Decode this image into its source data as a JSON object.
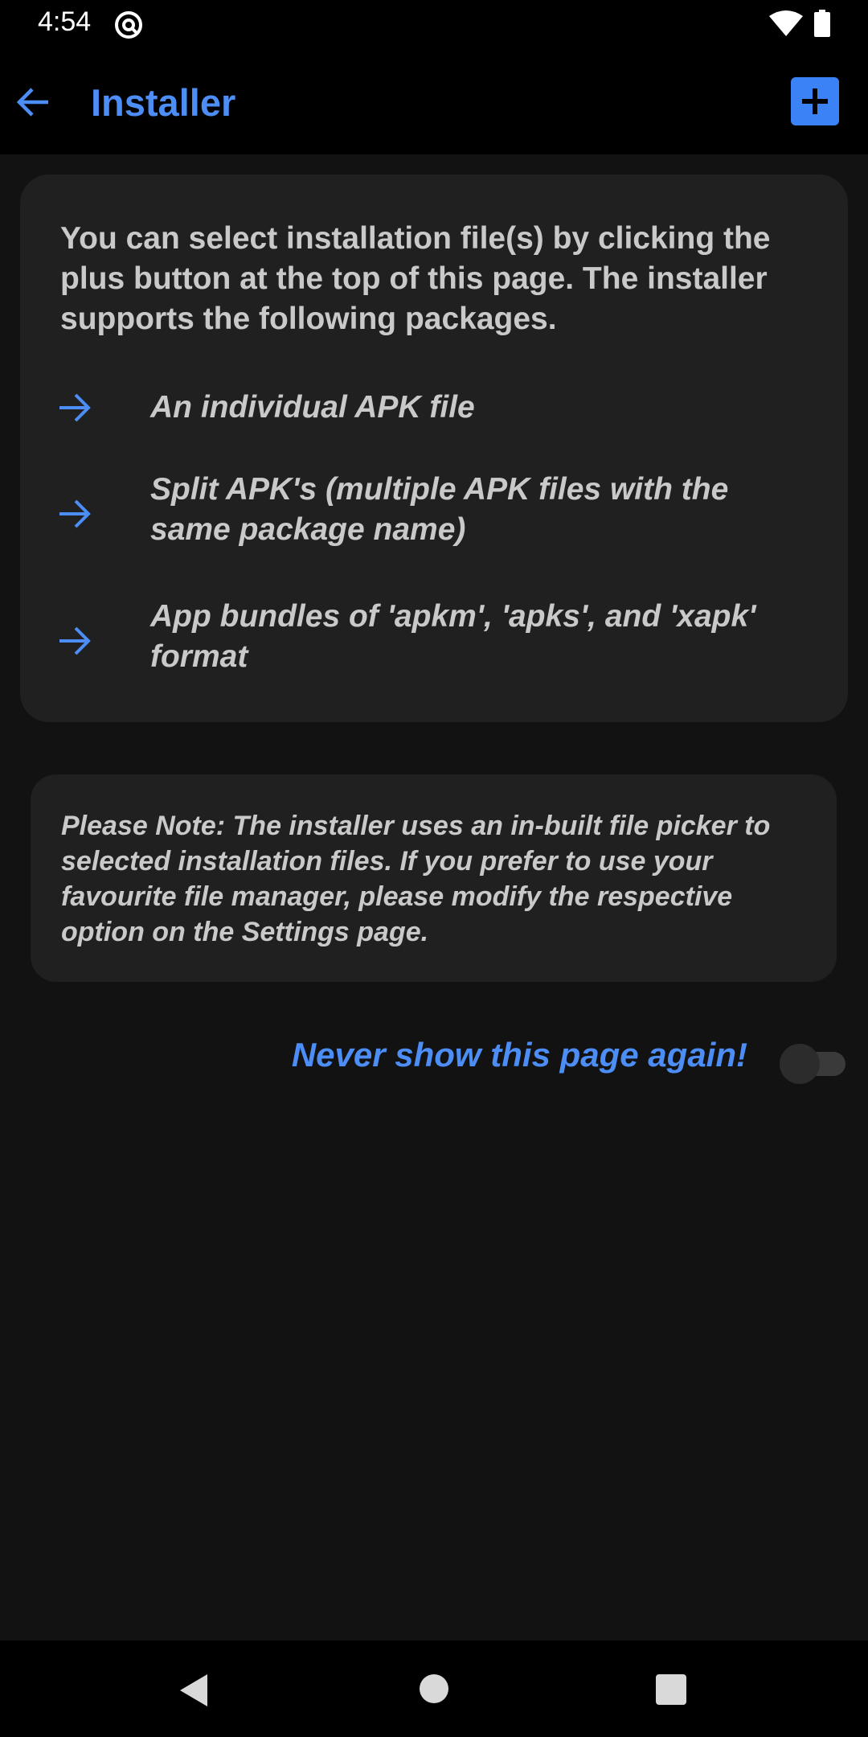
{
  "status_bar": {
    "time": "4:54"
  },
  "app_bar": {
    "title": "Installer",
    "back_icon": "arrow-left-icon",
    "add_icon": "plus-icon"
  },
  "info_card": {
    "intro": "You can select installation file(s) by clicking the plus button at the top of this page. The installer supports the following packages.",
    "items": [
      {
        "text": "An individual APK file"
      },
      {
        "text": "Split APK's (multiple APK files with the same package name)"
      },
      {
        "text": "App bundles of 'apkm', 'apks', and 'xapk' format"
      }
    ]
  },
  "note_card": {
    "text": "Please Note: The installer uses an in-built file picker to selected installation files. If you prefer to use your favourite file manager, please modify the respective option on the Settings page."
  },
  "never_show": {
    "label": "Never show this page again!",
    "enabled": false
  },
  "colors": {
    "accent": "#4c8df6",
    "background": "#121212",
    "card": "#202020",
    "text": "#c9c9c9"
  }
}
